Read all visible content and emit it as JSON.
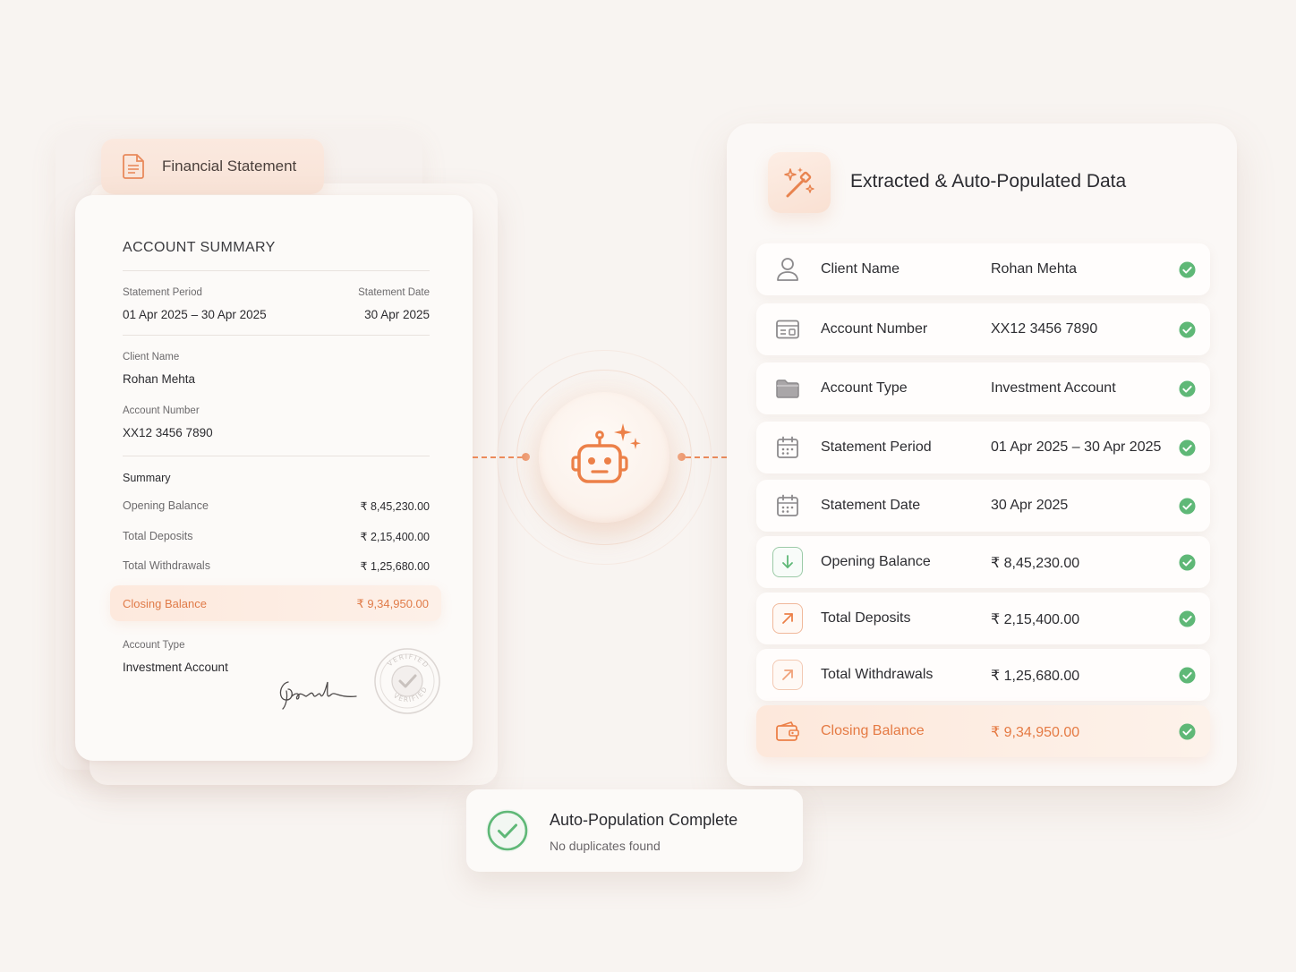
{
  "document": {
    "tab_label": "Financial Statement",
    "heading": "ACCOUNT SUMMARY",
    "statement_period_label": "Statement Period",
    "statement_period_value": "01 Apr 2025 – 30 Apr 2025",
    "statement_date_label": "Statement Date",
    "statement_date_value": "30 Apr 2025",
    "client_name_label": "Client Name",
    "client_name_value": "Rohan Mehta",
    "account_number_label": "Account Number",
    "account_number_value": "XX12 3456 7890",
    "summary_heading": "Summary",
    "opening_label": "Opening Balance",
    "opening_value": "₹ 8,45,230.00",
    "deposits_label": "Total Deposits",
    "deposits_value": "₹ 2,15,400.00",
    "withdrawals_label": "Total Withdrawals",
    "withdrawals_value": "₹ 1,25,680.00",
    "closing_label": "Closing Balance",
    "closing_value": "₹ 9,34,950.00",
    "account_type_label": "Account Type",
    "account_type_value": "Investment Account",
    "seal_text": "VERIFIED"
  },
  "panel": {
    "title": "Extracted & Auto-Populated Data",
    "rows": [
      {
        "label": "Client Name",
        "value": "Rohan Mehta",
        "icon": "user-icon"
      },
      {
        "label": "Account Number",
        "value": "XX12 3456 7890",
        "icon": "id-card-icon"
      },
      {
        "label": "Account Type",
        "value": "Investment Account",
        "icon": "folder-icon"
      },
      {
        "label": "Statement Period",
        "value": "01 Apr 2025 – 30 Apr 2025",
        "icon": "calendar-icon"
      },
      {
        "label": "Statement Date",
        "value": "30 Apr 2025",
        "icon": "calendar-icon"
      },
      {
        "label": "Opening Balance",
        "value": "₹ 8,45,230.00",
        "icon": "arrow-down-icon"
      },
      {
        "label": "Total Deposits",
        "value": "₹ 2,15,400.00",
        "icon": "arrow-up-right-icon"
      },
      {
        "label": "Total Withdrawals",
        "value": "₹ 1,25,680.00",
        "icon": "arrow-up-right-icon"
      },
      {
        "label": "Closing Balance",
        "value": "₹ 9,34,950.00",
        "icon": "wallet-icon"
      }
    ]
  },
  "toast": {
    "title": "Auto-Population Complete",
    "subtitle": "No duplicates found"
  },
  "colors": {
    "accent": "#ec8a5a",
    "success": "#5fb877",
    "background": "#f8f4f1"
  }
}
